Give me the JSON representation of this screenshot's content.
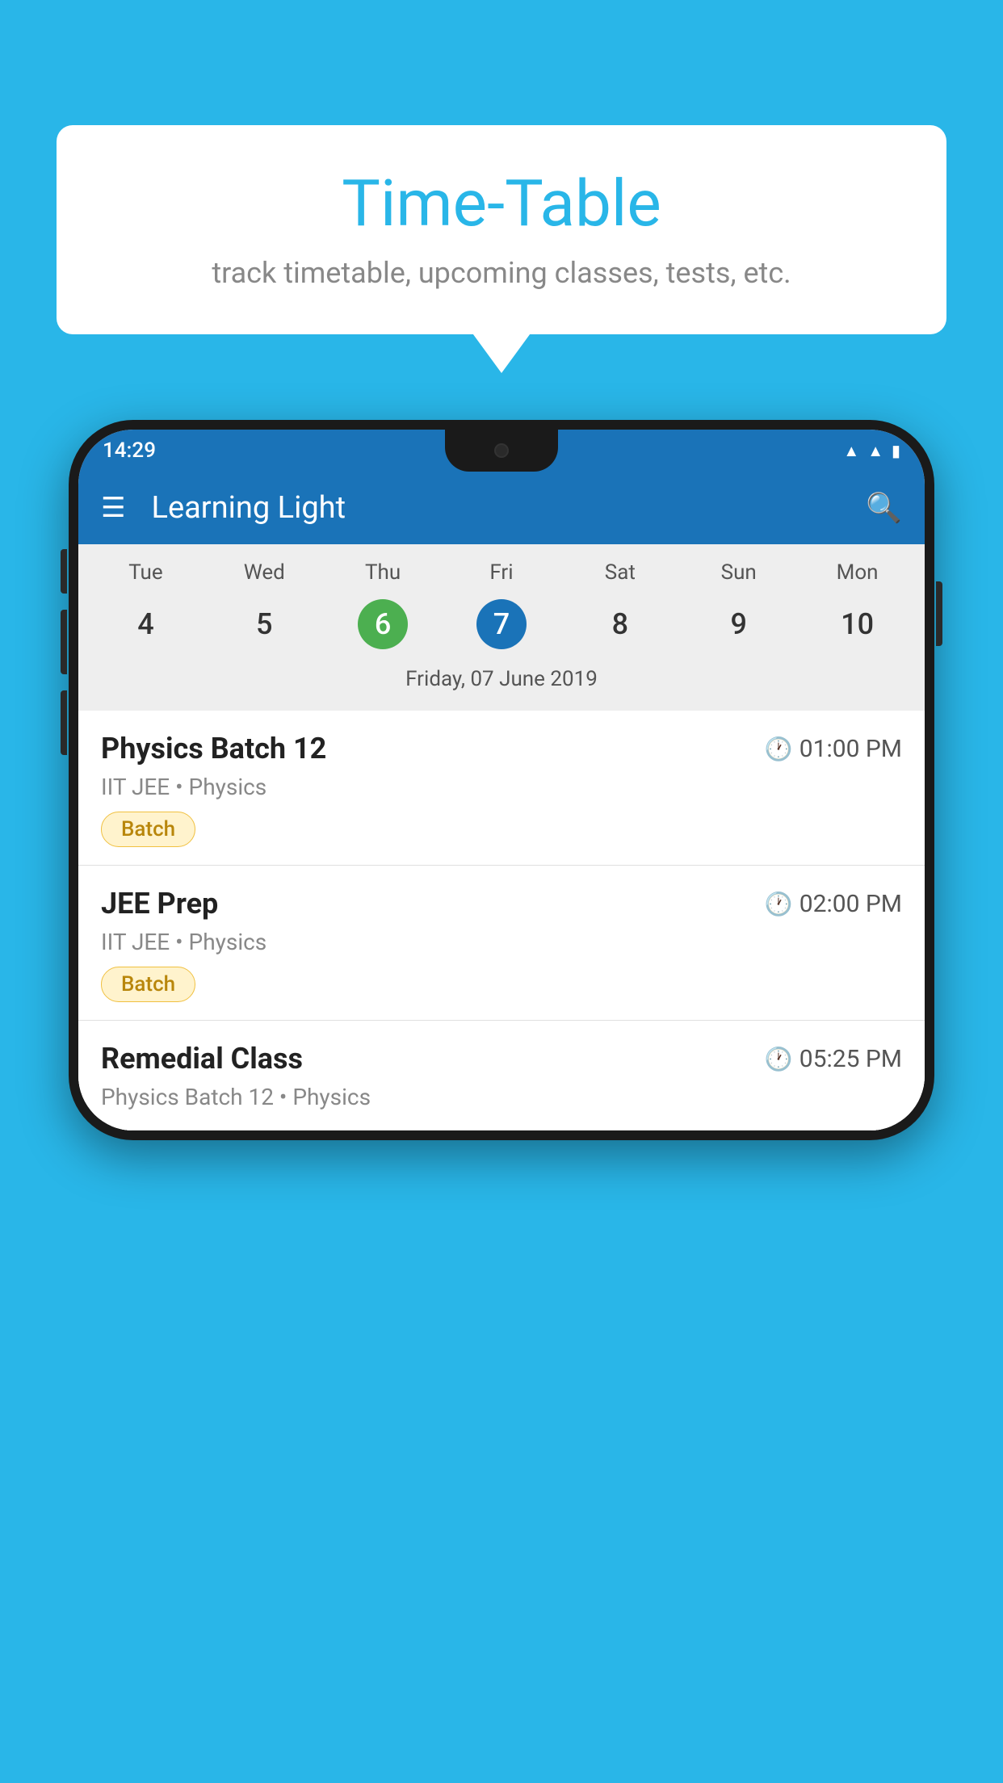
{
  "background_color": "#29b6e8",
  "bubble": {
    "title": "Time-Table",
    "subtitle": "track timetable, upcoming classes, tests, etc."
  },
  "phone": {
    "status_bar": {
      "time": "14:29"
    },
    "app_bar": {
      "title": "Learning Light"
    },
    "calendar": {
      "days": [
        {
          "name": "Tue",
          "num": "4",
          "state": "normal"
        },
        {
          "name": "Wed",
          "num": "5",
          "state": "normal"
        },
        {
          "name": "Thu",
          "num": "6",
          "state": "today"
        },
        {
          "name": "Fri",
          "num": "7",
          "state": "selected"
        },
        {
          "name": "Sat",
          "num": "8",
          "state": "normal"
        },
        {
          "name": "Sun",
          "num": "9",
          "state": "normal"
        },
        {
          "name": "Mon",
          "num": "10",
          "state": "normal"
        }
      ],
      "selected_date_label": "Friday, 07 June 2019"
    },
    "schedule_items": [
      {
        "title": "Physics Batch 12",
        "time": "01:00 PM",
        "subtitle": "IIT JEE • Physics",
        "badge": "Batch"
      },
      {
        "title": "JEE Prep",
        "time": "02:00 PM",
        "subtitle": "IIT JEE • Physics",
        "badge": "Batch"
      },
      {
        "title": "Remedial Class",
        "time": "05:25 PM",
        "subtitle": "Physics Batch 12 • Physics",
        "badge": null
      }
    ]
  }
}
